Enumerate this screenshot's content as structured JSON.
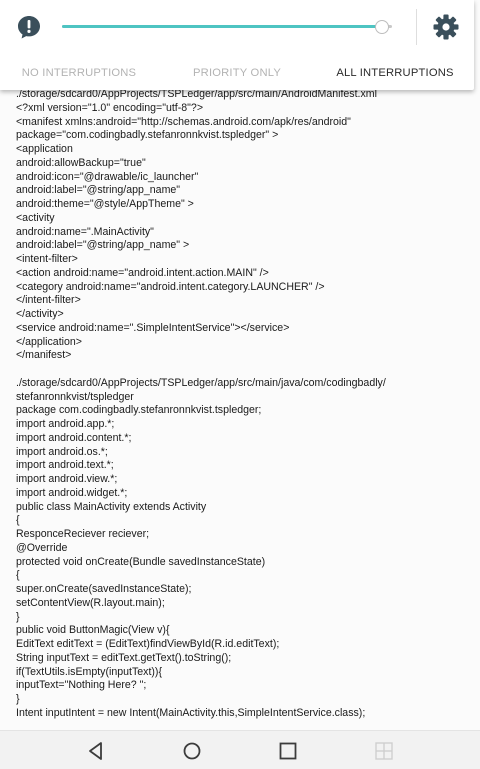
{
  "interruptions_panel": {
    "tabs": [
      {
        "label": "NO INTERRUPTIONS",
        "active": false
      },
      {
        "label": "PRIORITY ONLY",
        "active": false
      },
      {
        "label": "ALL INTERRUPTIONS",
        "active": true
      }
    ],
    "volume_level": 0.97,
    "accent_color": "#4ec4c2",
    "icons": [
      "alert-icon",
      "gear-icon"
    ]
  },
  "document": {
    "lines": [
      "./storage/sdcard0/AppProjects/TSPLedger/app/src/main/AndroidManifest.xml",
      "<?xml version=\"1.0\" encoding=\"utf-8\"?>",
      "<manifest xmlns:android=\"http://schemas.android.com/apk/res/android\"",
      "package=\"com.codingbadly.stefanronnkvist.tspledger\" >",
      "<application",
      "android:allowBackup=\"true\"",
      "android:icon=\"@drawable/ic_launcher\"",
      "android:label=\"@string/app_name\"",
      "android:theme=\"@style/AppTheme\" >",
      "<activity",
      "android:name=\".MainActivity\"",
      "android:label=\"@string/app_name\" >",
      "<intent-filter>",
      "<action android:name=\"android.intent.action.MAIN\" />",
      "<category android:name=\"android.intent.category.LAUNCHER\" />",
      "</intent-filter>",
      "</activity>",
      "<service android:name=\".SimpleIntentService\"></service>",
      "</application>",
      "</manifest>",
      "",
      "./storage/sdcard0/AppProjects/TSPLedger/app/src/main/java/com/codingbadly/",
      "stefanronnkvist/tspledger",
      "package com.codingbadly.stefanronnkvist.tspledger;",
      "import android.app.*;",
      "import android.content.*;",
      "import android.os.*;",
      "import android.text.*;",
      "import android.view.*;",
      "import android.widget.*;",
      "public class MainActivity extends Activity",
      "{",
      "ResponceReciever reciever;",
      "@Override",
      "protected void onCreate(Bundle savedInstanceState)",
      "{",
      "super.onCreate(savedInstanceState);",
      "setContentView(R.layout.main);",
      "}",
      "public void ButtonMagic(View v){",
      "EditText editText = (EditText)findViewById(R.id.editText);",
      "String inputText = editText.getText().toString();",
      "if(TextUtils.isEmpty(inputText)){",
      "inputText=\"Nothing Here? \";",
      "}",
      "Intent inputIntent = new Intent(MainActivity.this,SimpleIntentService.class);"
    ]
  },
  "navigation_bar": {
    "buttons": [
      "back-icon",
      "home-icon",
      "recents-icon",
      "multiwindow-icon"
    ]
  }
}
